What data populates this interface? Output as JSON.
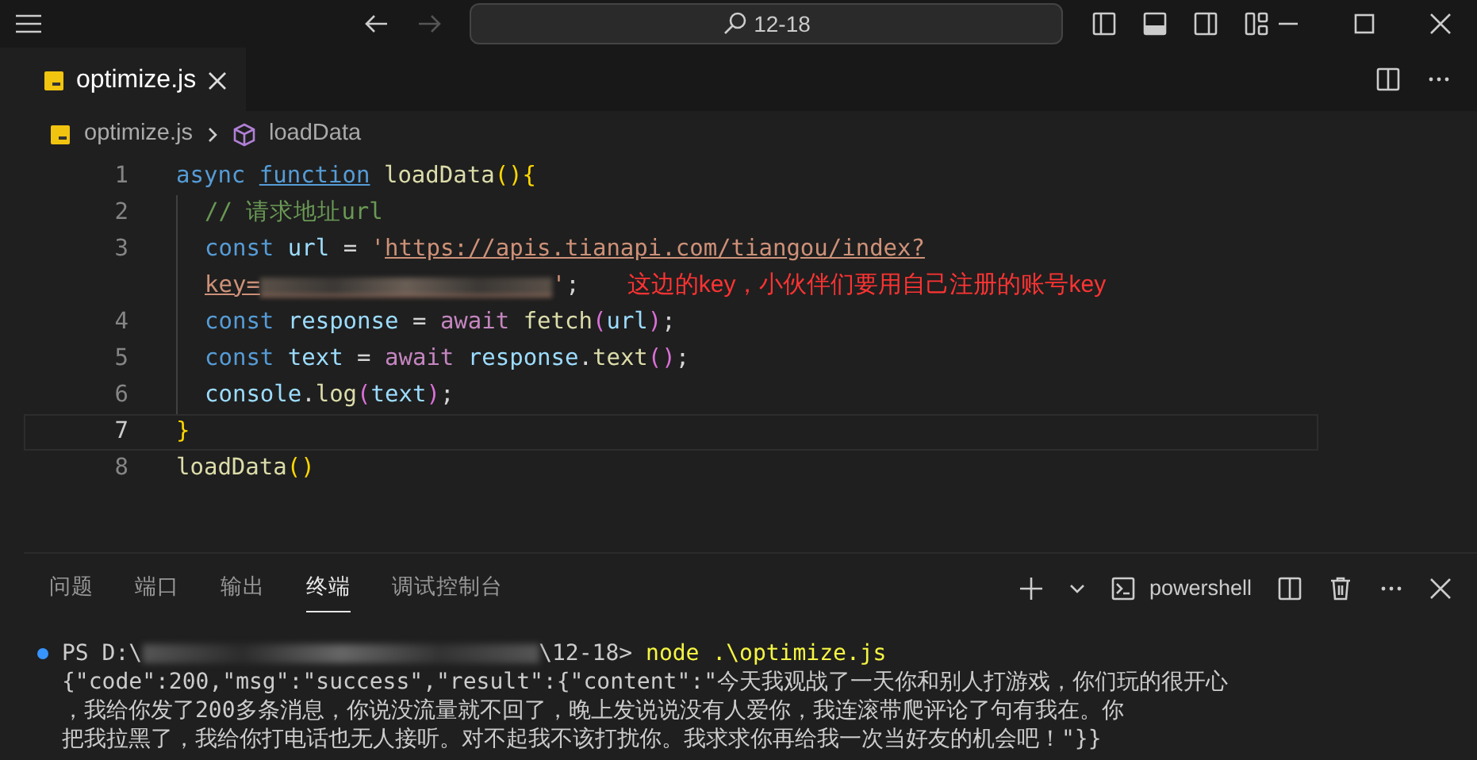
{
  "title_bar": {
    "search_text": "12-18",
    "forward_disabled": true
  },
  "tabs": [
    {
      "label": "optimize.js",
      "selected": true
    }
  ],
  "breadcrumbs": [
    {
      "label": "optimize.js",
      "kind": "file"
    },
    {
      "label": "loadData",
      "kind": "symbol"
    }
  ],
  "editor": {
    "lines": [
      {
        "number": "1",
        "tokens": [
          {
            "t": "async ",
            "kind": "keyword"
          },
          {
            "t": "function",
            "kind": "hovered"
          },
          {
            "t": " loadData",
            "kind": "function"
          },
          {
            "t": "(){",
            "kind": "bracket"
          }
        ]
      },
      {
        "number": "2",
        "tokens": [
          {
            "t": "// 请求地址url",
            "kind": "comment"
          }
        ]
      },
      {
        "number": "3",
        "tokens": [
          {
            "t": "const ",
            "kind": "keyword"
          },
          {
            "t": "url",
            "kind": "variable"
          },
          {
            "t": " = ",
            "kind": "plain"
          },
          {
            "t": "'",
            "kind": "string"
          },
          {
            "t": "https://apis.tianapi.com/tiangou/index?",
            "kind": "url"
          }
        ]
      },
      {
        "tokens": [
          {
            "t": "key=",
            "kind": "url"
          },
          {
            "kind": "blurred"
          },
          {
            "t": "'",
            "kind": "string"
          },
          {
            "t": ";",
            "kind": "plain"
          }
        ],
        "note": "这边的key，小伙伴们要用自己注册的账号key"
      },
      {
        "number": "4",
        "tokens": [
          {
            "t": "const ",
            "kind": "keyword"
          },
          {
            "t": "response",
            "kind": "variable"
          },
          {
            "t": " = ",
            "kind": "plain"
          },
          {
            "t": "await ",
            "kind": "control"
          },
          {
            "t": "fetch",
            "kind": "function"
          },
          {
            "t": "(",
            "kind": "paren"
          },
          {
            "t": "url",
            "kind": "variable"
          },
          {
            "t": ")",
            "kind": "paren"
          },
          {
            "t": ";",
            "kind": "plain"
          }
        ]
      },
      {
        "number": "5",
        "tokens": [
          {
            "t": "const ",
            "kind": "keyword"
          },
          {
            "t": "text",
            "kind": "variable"
          },
          {
            "t": " = ",
            "kind": "plain"
          },
          {
            "t": "await ",
            "kind": "control"
          },
          {
            "t": "response",
            "kind": "variable"
          },
          {
            "t": ".",
            "kind": "plain"
          },
          {
            "t": "text",
            "kind": "function"
          },
          {
            "t": "()",
            "kind": "paren"
          },
          {
            "t": ";",
            "kind": "plain"
          }
        ]
      },
      {
        "number": "6",
        "tokens": [
          {
            "t": "console",
            "kind": "variable"
          },
          {
            "t": ".",
            "kind": "plain"
          },
          {
            "t": "log",
            "kind": "function"
          },
          {
            "t": "(",
            "kind": "paren"
          },
          {
            "t": "text",
            "kind": "variable"
          },
          {
            "t": ")",
            "kind": "paren"
          },
          {
            "t": ";",
            "kind": "plain"
          }
        ]
      },
      {
        "number": "7",
        "tokens": [
          {
            "t": "}",
            "kind": "bracket"
          }
        ],
        "current": true
      },
      {
        "number": "8",
        "tokens": [
          {
            "t": "loadData",
            "kind": "function"
          },
          {
            "t": "()",
            "kind": "bracket"
          }
        ]
      }
    ]
  },
  "panel": {
    "tabs": [
      {
        "label": "问题",
        "selected": false
      },
      {
        "label": "端口",
        "selected": false
      },
      {
        "label": "输出",
        "selected": false
      },
      {
        "label": "终端",
        "selected": true
      },
      {
        "label": "调试控制台",
        "selected": false
      }
    ],
    "shell": "powershell",
    "prompt": {
      "start": "PS D:\\",
      "end": "\\12-18>",
      "command": "node .\\optimize.js"
    },
    "output": [
      "{\"code\":200,\"msg\":\"success\",\"result\":{\"content\":\"今天我观战了一天你和别人打游戏，你们玩的很开心",
      "，我给你发了200多条消息，你说没流量就不回了，晚上发说说没有人爱你，我连滚带爬评论了句有我在。你",
      "把我拉黑了，我给你打电话也无人接听。对不起我不该打扰你。我求求你再给我一次当好友的机会吧！\"}}"
    ]
  }
}
